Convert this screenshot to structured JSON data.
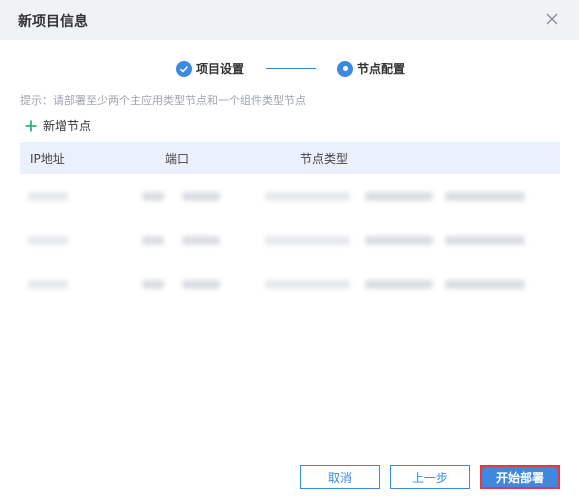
{
  "dialog": {
    "title": "新项目信息"
  },
  "steps": [
    {
      "label": "项目设置",
      "state": "completed"
    },
    {
      "label": "节点配置",
      "state": "active"
    }
  ],
  "hint": "提示：请部署至少两个主应用类型节点和一个组件类型节点",
  "add_node_label": "新增节点",
  "table": {
    "columns": [
      "IP地址",
      "端口",
      "节点类型"
    ],
    "rows_count_visible_blurred": 3
  },
  "footer": {
    "cancel_label": "取消",
    "prev_label": "上一步",
    "start_label": "开始部署"
  },
  "colors": {
    "accent": "#3c89e4",
    "add_icon": "#2bb673",
    "header_bg": "#f0f2f6",
    "table_header_bg": "#eaf1fc",
    "highlight_border": "#e23b3b"
  }
}
